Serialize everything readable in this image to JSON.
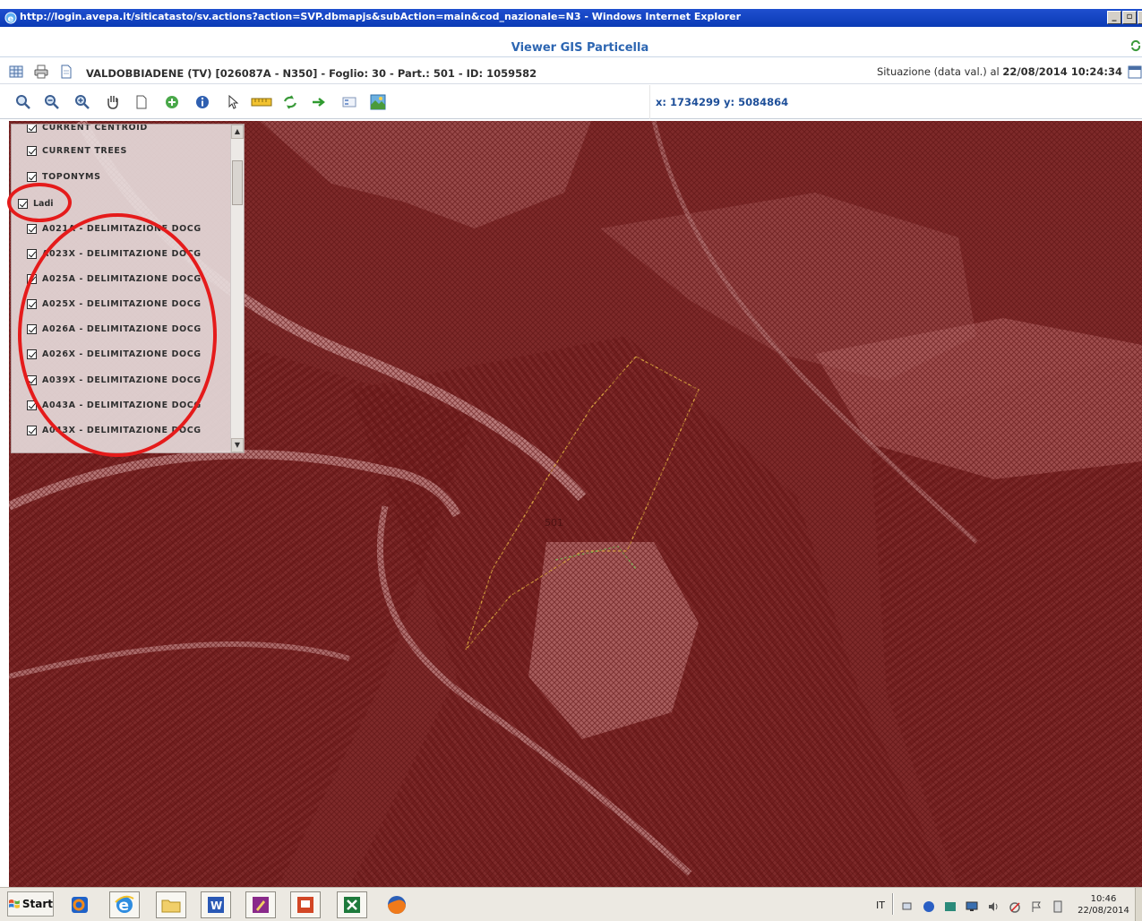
{
  "window": {
    "title": "http://login.avepa.it/siticatasto/sv.actions?action=SVP.dbmapjs&subAction=main&cod_nazionale=N3 - Windows Internet Explorer",
    "buttons": [
      "_",
      "▫",
      "x"
    ]
  },
  "viewer": {
    "title": "Viewer GIS Particella"
  },
  "info_bar": {
    "parcel": "VALDOBBIADENE (TV) [026087A - N350] - Foglio: 30 - Part.: 501 - ID: 1059582",
    "situation_prefix": "Situazione (data val.) al ",
    "situation_date": "22/08/2014 10:24:34"
  },
  "toolbar": {
    "coords": "x: 1734299 y: 5084864",
    "tools": [
      "search-icon",
      "zoom-out-icon",
      "zoom-in-icon",
      "pan-hand-icon",
      "page-icon",
      "add-green-icon",
      "info-icon",
      "select-pointer-icon",
      "ruler-icon",
      "refresh-icon",
      "arrow-right-icon",
      "legend-icon",
      "map-layers-icon"
    ]
  },
  "layers": {
    "items": [
      {
        "label": "CURRENT CENTROID",
        "checked": true
      },
      {
        "label": "CURRENT TREES",
        "checked": true
      },
      {
        "label": "TOPONYMS",
        "checked": true
      },
      {
        "label": "Ladi",
        "checked": true
      },
      {
        "label": "A021A - DELIMITAZIONE DOCG",
        "checked": true
      },
      {
        "label": "A023X - DELIMITAZIONE DOCG",
        "checked": true
      },
      {
        "label": "A025A - DELIMITAZIONE DOCG",
        "checked": true
      },
      {
        "label": "A025X - DELIMITAZIONE DOCG",
        "checked": true
      },
      {
        "label": "A026A - DELIMITAZIONE DOCG",
        "checked": true
      },
      {
        "label": "A026X - DELIMITAZIONE DOCG",
        "checked": true
      },
      {
        "label": "A039X - DELIMITAZIONE DOCG",
        "checked": true
      },
      {
        "label": "A043A - DELIMITAZIONE DOCG",
        "checked": true
      },
      {
        "label": "A043X - DELIMITAZIONE DOCG",
        "checked": true
      }
    ]
  },
  "map": {
    "parcel_label": "501",
    "overlay_color": "#7a1a1a",
    "highlight_color": "#e51b1b"
  },
  "taskbar": {
    "start_label": "Start",
    "language": "IT",
    "time": "10:46",
    "date": "22/08/2014"
  }
}
